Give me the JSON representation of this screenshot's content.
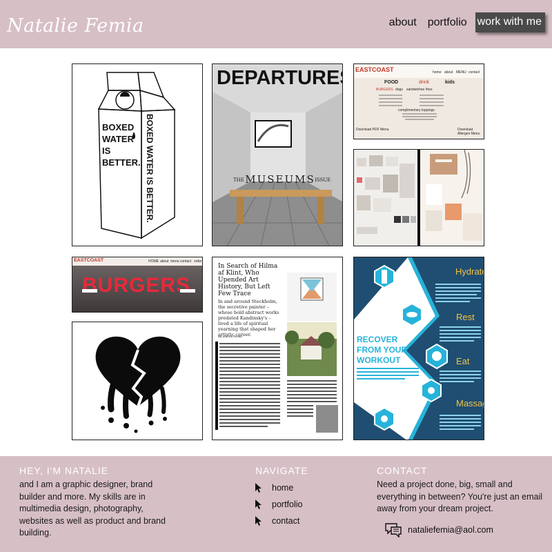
{
  "header": {
    "logo": "Natalie Femia",
    "nav": [
      {
        "label": "about"
      },
      {
        "label": "portfolio"
      },
      {
        "label": "work with me"
      }
    ]
  },
  "portfolio": {
    "boxed_water": {
      "lines": [
        "BOXED",
        "WATER",
        "IS",
        "BETTER."
      ],
      "side": "BOXED WATER IS BETTER."
    },
    "departures": {
      "title": "DEPARTURES",
      "the": "THE",
      "museums": "MUSEUMS",
      "issue": "ISSUE"
    },
    "menu": {
      "brand": "EASTCOAST",
      "nav": [
        "home",
        "about",
        "MENU",
        "contact"
      ],
      "tabs": [
        "FOOD",
        "drink",
        "kids"
      ],
      "subtabs": [
        "BURGERS",
        "dogs",
        "sandwiches",
        "fries"
      ],
      "section": "complimentary toppings",
      "left_link": "Download PDF Menu",
      "right_link": "Download Allergen Menu"
    },
    "burgers": {
      "brand": "EASTCOAST",
      "nav": [
        "HOME",
        "about",
        "menu",
        "contact",
        "order"
      ],
      "sign": "BURGERS"
    },
    "article": {
      "headline": "In Search of Hilma af Klint, Who Upended Art History, But Left Few Trace",
      "dek": "In and around Stockholm, the secretive painter – whose bold abstract works predated Kandinsky's – lived a life of spiritual yearning that shaped her artistic career.",
      "byline": "By Andrea Femia"
    },
    "workout": {
      "title_lines": [
        "RECOVER",
        "FROM YOUR",
        "WORKOUT"
      ],
      "labels": [
        "Hydrate",
        "Rest",
        "Eat",
        "Massage"
      ]
    }
  },
  "footer": {
    "about": {
      "heading": "HEY, I'M NATALIE",
      "text": "and I am a graphic designer, brand builder and more. My skills are in multimedia design, photography, websites as well as product and brand building."
    },
    "navigate": {
      "heading": "NAVIGATE",
      "items": [
        {
          "label": "home"
        },
        {
          "label": "portfolio"
        },
        {
          "label": "contact"
        }
      ]
    },
    "contact": {
      "heading": "CONTACT",
      "text": "Need a project done, big, small and everything in between? You're just an email away from your dream project.",
      "email": "nataliefemia@aol.com"
    }
  },
  "colors": {
    "brand_pink": "#d7bfc6",
    "button_dark": "#4a4a4a",
    "workout_blue": "#1f4e72",
    "workout_teal": "#27b3d9",
    "burger_red": "#e8293a"
  }
}
